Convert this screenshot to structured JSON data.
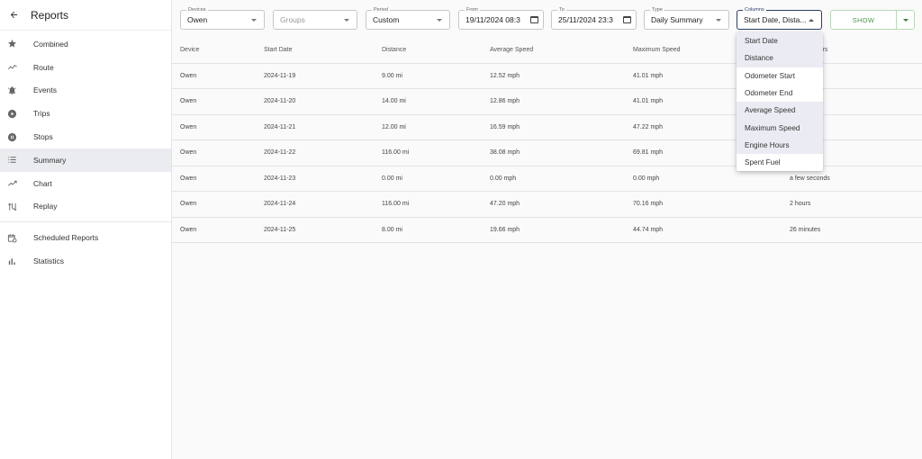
{
  "sidebar": {
    "title": "Reports",
    "back_icon": "arrow-left-icon",
    "items": [
      {
        "label": "Combined",
        "icon": "star-icon",
        "active": false
      },
      {
        "label": "Route",
        "icon": "timeline-icon",
        "active": false
      },
      {
        "label": "Events",
        "icon": "alarm-bell-icon",
        "active": false
      },
      {
        "label": "Trips",
        "icon": "play-circle-icon",
        "active": false
      },
      {
        "label": "Stops",
        "icon": "pause-circle-icon",
        "active": false
      },
      {
        "label": "Summary",
        "icon": "list-icon",
        "active": true
      },
      {
        "label": "Chart",
        "icon": "trending-up-icon",
        "active": false
      },
      {
        "label": "Replay",
        "icon": "replay-route-icon",
        "active": false
      }
    ],
    "secondary_items": [
      {
        "label": "Scheduled Reports",
        "icon": "calendar-refresh-icon"
      },
      {
        "label": "Statistics",
        "icon": "bar-chart-icon"
      }
    ]
  },
  "toolbar": {
    "devices": {
      "label": "Devices",
      "value": "Owen"
    },
    "groups": {
      "label": "",
      "placeholder": "Groups"
    },
    "period": {
      "label": "Period",
      "value": "Custom"
    },
    "from": {
      "label": "From",
      "value": "19/11/2024 08:3"
    },
    "to": {
      "label": "To",
      "value": "25/11/2024 23:3"
    },
    "type": {
      "label": "Type",
      "value": "Daily Summary"
    },
    "columns": {
      "label": "Columns",
      "value": "Start Date, Dista..."
    },
    "show_label": "SHOW"
  },
  "columns_menu": {
    "options": [
      {
        "label": "Start Date",
        "selected": true
      },
      {
        "label": "Distance",
        "selected": true
      },
      {
        "label": "Odometer Start",
        "selected": false
      },
      {
        "label": "Odometer End",
        "selected": false
      },
      {
        "label": "Average Speed",
        "selected": true
      },
      {
        "label": "Maximum Speed",
        "selected": true
      },
      {
        "label": "Engine Hours",
        "selected": true
      },
      {
        "label": "Spent Fuel",
        "selected": false
      }
    ]
  },
  "table": {
    "headers": [
      "Device",
      "Start Date",
      "Distance",
      "Average Speed",
      "Maximum Speed",
      "Engine Hours"
    ],
    "rows": [
      [
        "Owen",
        "2024-11-19",
        "9.00 mi",
        "12.52 mph",
        "41.01 mph",
        ""
      ],
      [
        "Owen",
        "2024-11-20",
        "14.00 mi",
        "12.86 mph",
        "41.01 mph",
        ""
      ],
      [
        "Owen",
        "2024-11-21",
        "12.00 mi",
        "16.59 mph",
        "47.22 mph",
        ""
      ],
      [
        "Owen",
        "2024-11-22",
        "116.00 mi",
        "38.08 mph",
        "69.81 mph",
        ""
      ],
      [
        "Owen",
        "2024-11-23",
        "0.00 mi",
        "0.00 mph",
        "0.00 mph",
        "a few seconds"
      ],
      [
        "Owen",
        "2024-11-24",
        "116.00 mi",
        "47.20 mph",
        "70.16 mph",
        "2 hours"
      ],
      [
        "Owen",
        "2024-11-25",
        "8.00 mi",
        "19.66 mph",
        "44.74 mph",
        "26 minutes"
      ]
    ]
  }
}
